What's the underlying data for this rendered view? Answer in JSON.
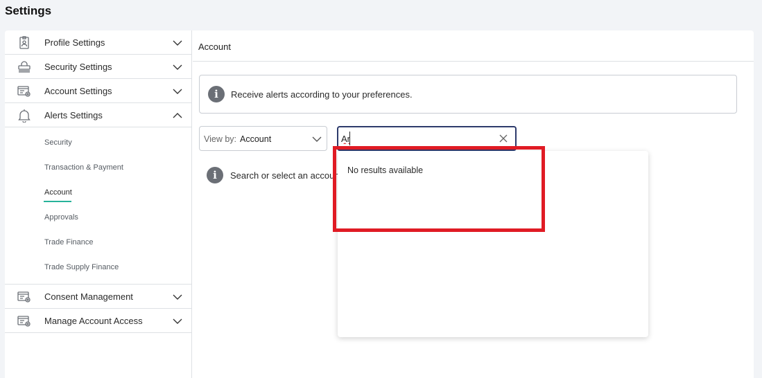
{
  "page": {
    "title": "Settings"
  },
  "sidebar": {
    "items": [
      {
        "label": "Profile Settings",
        "icon": "profile-card-icon",
        "expanded": false
      },
      {
        "label": "Security Settings",
        "icon": "security-lock-icon",
        "expanded": false
      },
      {
        "label": "Account Settings",
        "icon": "account-settings-icon",
        "expanded": false
      },
      {
        "label": "Alerts Settings",
        "icon": "bell-settings-icon",
        "expanded": true
      },
      {
        "label": "Consent Management",
        "icon": "consent-settings-icon",
        "expanded": false
      },
      {
        "label": "Manage Account Access",
        "icon": "account-access-icon",
        "expanded": false
      }
    ],
    "alerts_subitems": [
      {
        "label": "Security"
      },
      {
        "label": "Transaction & Payment"
      },
      {
        "label": "Account",
        "active": true
      },
      {
        "label": "Approvals"
      },
      {
        "label": "Trade Finance"
      },
      {
        "label": "Trade Supply Finance"
      }
    ]
  },
  "main": {
    "title": "Account",
    "alert_text": "Receive alerts according to your preferences.",
    "viewby": {
      "label": "View by:",
      "value": "Account"
    },
    "search": {
      "value": "Ar"
    },
    "empty_text": "Search or select an account",
    "dropdown": {
      "no_results": "No results available"
    }
  },
  "colors": {
    "accent_underline": "#27b39a",
    "highlight_box": "#e01b24",
    "search_border": "#2d3a6b"
  }
}
